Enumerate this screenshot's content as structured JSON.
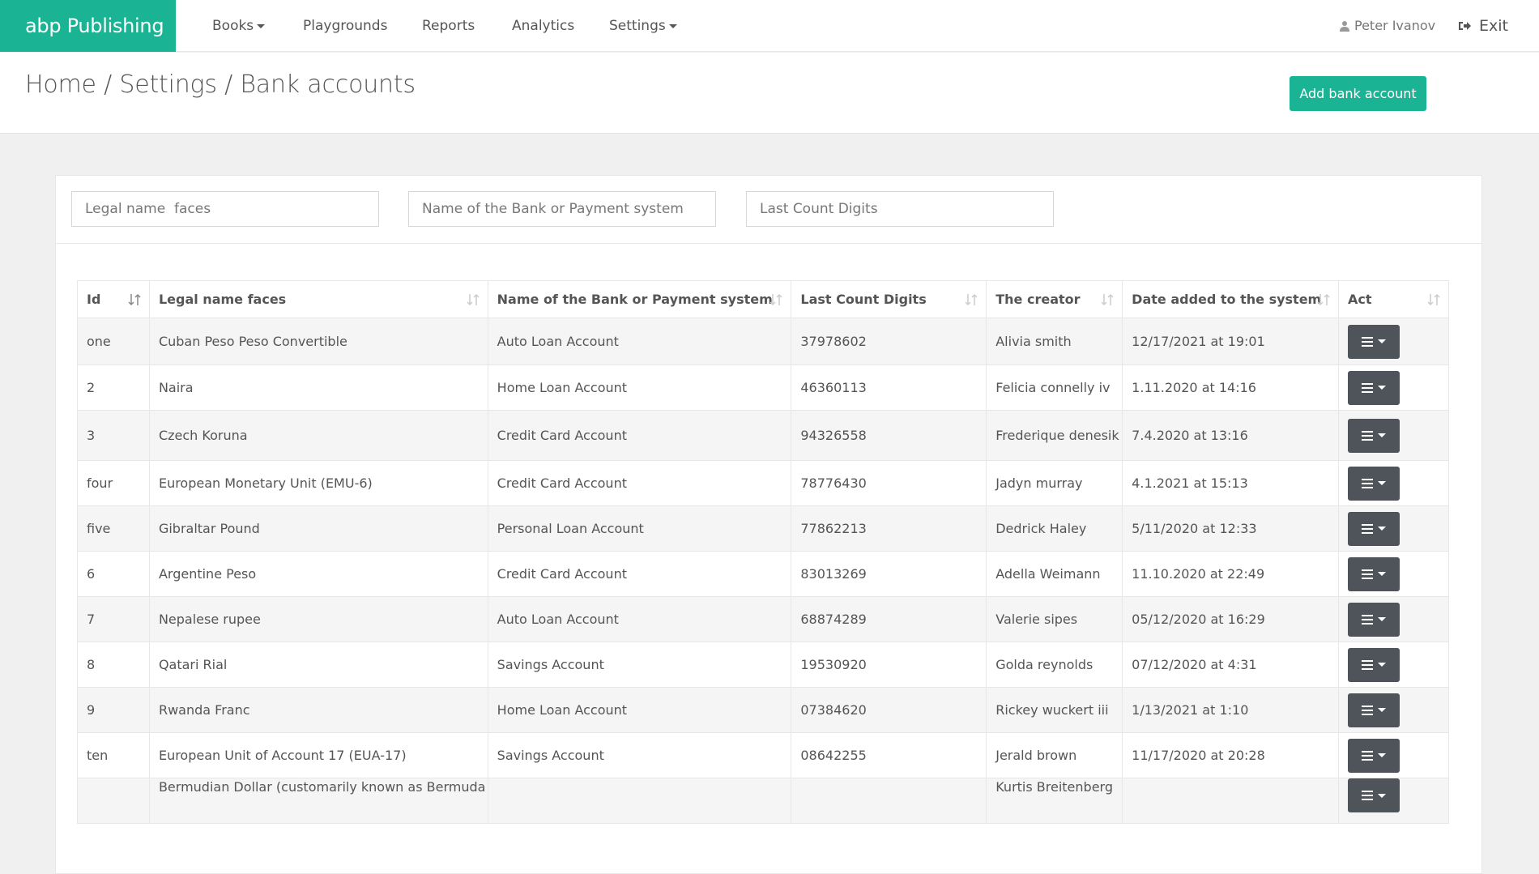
{
  "brand": "abp Publishing",
  "nav": {
    "books": "Books",
    "playgrounds": "Playgrounds",
    "reports": "Reports",
    "analytics": "Analytics",
    "settings": "Settings"
  },
  "user": {
    "name": "Peter Ivanov",
    "exit": "Exit"
  },
  "breadcrumb": "Home / Settings / Bank accounts",
  "add_button": "Add bank account",
  "filters": {
    "legal": "Legal name  faces",
    "bank": "Name of the Bank or Payment system",
    "digits": "Last Count Digits"
  },
  "table": {
    "headers": [
      "Id",
      "Legal name faces",
      "Name of the Bank or Payment system",
      "Last Count Digits",
      "The creator",
      "Date added to the system",
      "Act"
    ],
    "rows": [
      [
        "one",
        "Cuban Peso Peso Convertible",
        "Auto Loan Account",
        "37978602",
        "Alivia smith",
        "12/17/2021 at 19:01"
      ],
      [
        "2",
        "Naira",
        "Home Loan Account",
        "46360113",
        "Felicia connelly iv",
        "1.11.2020 at 14:16"
      ],
      [
        "3",
        "Czech Koruna",
        "Credit Card Account",
        "94326558",
        "Frederique denesik",
        "7.4.2020 at 13:16"
      ],
      [
        "four",
        "European Monetary Unit (EMU-6)",
        "Credit Card Account",
        "78776430",
        "Jadyn murray",
        "4.1.2021 at 15:13"
      ],
      [
        "five",
        "Gibraltar Pound",
        "Personal Loan Account",
        "77862213",
        "Dedrick Haley",
        "5/11/2020 at 12:33"
      ],
      [
        "6",
        "Argentine Peso",
        "Credit Card Account",
        "83013269",
        "Adella Weimann",
        "11.10.2020 at 22:49"
      ],
      [
        "7",
        "Nepalese rupee",
        "Auto Loan Account",
        "68874289",
        "Valerie sipes",
        "05/12/2020 at 16:29"
      ],
      [
        "8",
        "Qatari Rial",
        "Savings Account",
        "19530920",
        "Golda reynolds",
        "07/12/2020 at 4:31"
      ],
      [
        "9",
        "Rwanda Franc",
        "Home Loan Account",
        "07384620",
        "Rickey wuckert iii",
        "1/13/2021 at 1:10"
      ],
      [
        "ten",
        "European Unit of Account 17 (EUA-17)",
        "Savings Account",
        "08642255",
        "Jerald brown",
        "11/17/2020 at 20:28"
      ],
      [
        "",
        "Bermudian Dollar (customarily known as Bermuda",
        "",
        "",
        "Kurtis Breitenberg",
        ""
      ]
    ]
  },
  "colors": {
    "brand": "#1ab394",
    "action_button": "#4e5459"
  }
}
